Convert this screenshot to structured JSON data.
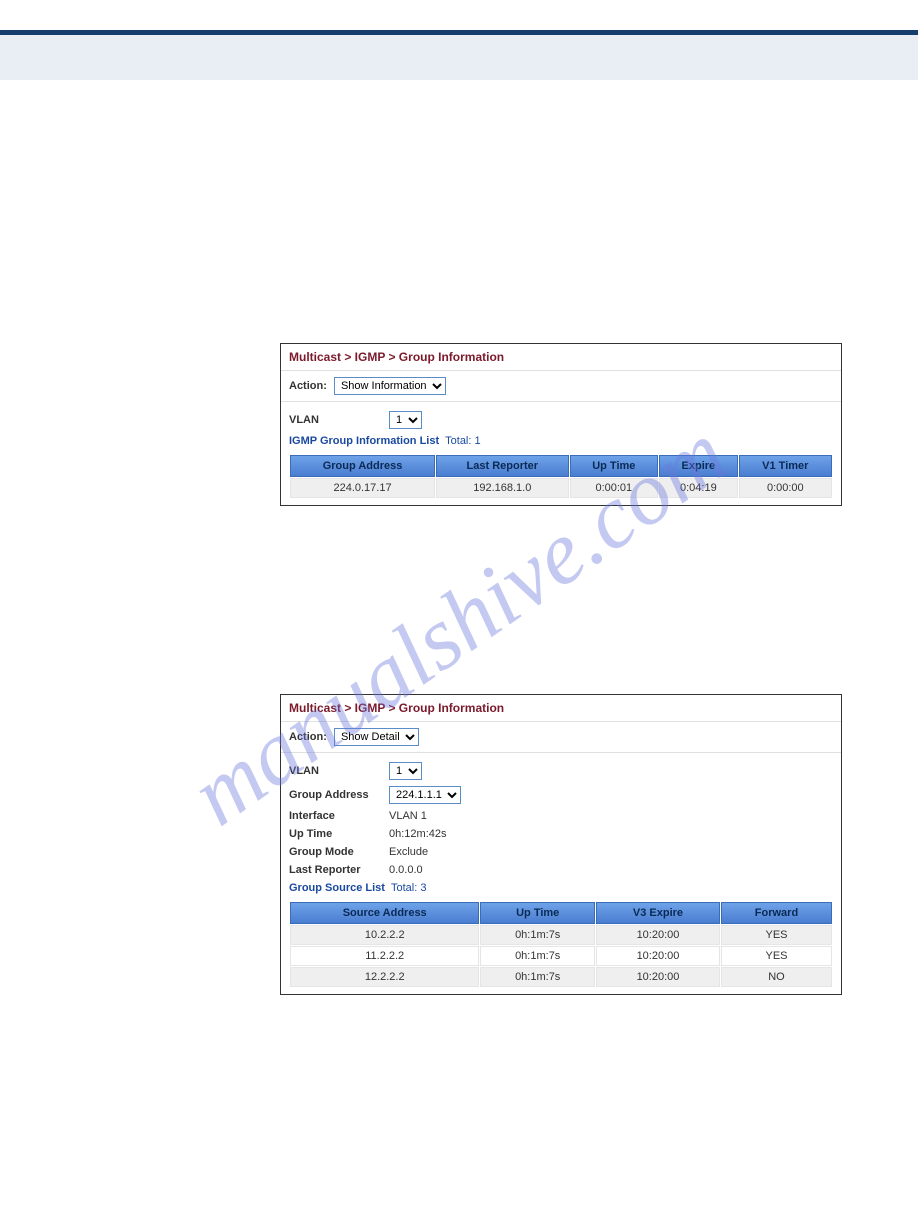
{
  "watermark": "manualshive.com",
  "panel1": {
    "breadcrumb": "Multicast > IGMP > Group Information",
    "action_label": "Action:",
    "action_value": "Show Information",
    "vlan_label": "VLAN",
    "vlan_value": "1",
    "list_title": "IGMP Group Information List",
    "list_total": "Total: 1",
    "headers": [
      "Group Address",
      "Last Reporter",
      "Up Time",
      "Expire",
      "V1 Timer"
    ],
    "rows": [
      [
        "224.0.17.17",
        "192.168.1.0",
        "0:00:01",
        "0:04:19",
        "0:00:00"
      ]
    ]
  },
  "panel2": {
    "breadcrumb": "Multicast > IGMP > Group Information",
    "action_label": "Action:",
    "action_value": "Show Detail",
    "vlan_label": "VLAN",
    "vlan_value": "1",
    "group_address_label": "Group Address",
    "group_address_value": "224.1.1.1",
    "interface_label": "Interface",
    "interface_value": "VLAN 1",
    "uptime_label": "Up Time",
    "uptime_value": "0h:12m:42s",
    "groupmode_label": "Group Mode",
    "groupmode_value": "Exclude",
    "lastreporter_label": "Last Reporter",
    "lastreporter_value": "0.0.0.0",
    "list_title": "Group Source List",
    "list_total": "Total: 3",
    "headers": [
      "Source Address",
      "Up Time",
      "V3 Expire",
      "Forward"
    ],
    "rows": [
      [
        "10.2.2.2",
        "0h:1m:7s",
        "10:20:00",
        "YES"
      ],
      [
        "11.2.2.2",
        "0h:1m:7s",
        "10:20:00",
        "YES"
      ],
      [
        "12.2.2.2",
        "0h:1m:7s",
        "10:20:00",
        "NO"
      ]
    ]
  }
}
